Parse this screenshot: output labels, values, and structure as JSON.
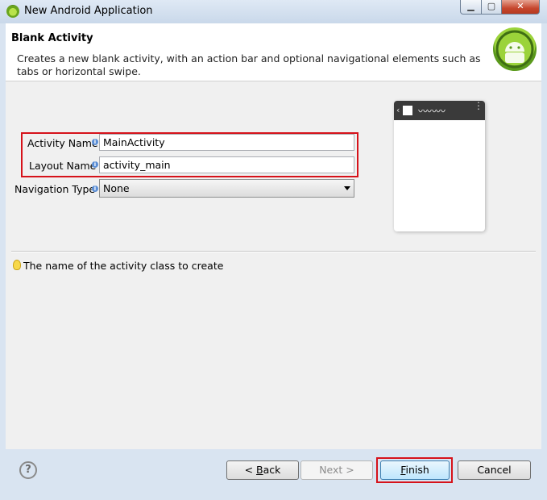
{
  "window": {
    "title": "New Android Application",
    "minimize_glyph": "▁",
    "maximize_glyph": "▢",
    "close_glyph": "✕"
  },
  "header": {
    "title": "Blank Activity",
    "description": "Creates a new blank activity, with an action bar and optional navigational elements such as tabs or horizontal swipe."
  },
  "form": {
    "activity_name": {
      "label": "Activity Name",
      "value": "MainActivity"
    },
    "layout_name": {
      "label": "Layout Name",
      "value": "activity_main"
    },
    "navigation_type": {
      "label": "Navigation Type",
      "value": "None"
    }
  },
  "preview": {
    "back_glyph": "‹",
    "title_wave": "〰〰〰",
    "menu_glyph": "⋮"
  },
  "hint": {
    "text": "The name of the activity class to create"
  },
  "buttons": {
    "help": "?",
    "back": {
      "prefix": "< ",
      "mnemonic": "B",
      "rest": "ack"
    },
    "next": {
      "label": "Next >"
    },
    "finish": {
      "mnemonic": "F",
      "rest": "inish"
    },
    "cancel": {
      "label": "Cancel"
    }
  },
  "colors": {
    "highlight": "#d6121a",
    "android_green": "#9bd33a"
  }
}
